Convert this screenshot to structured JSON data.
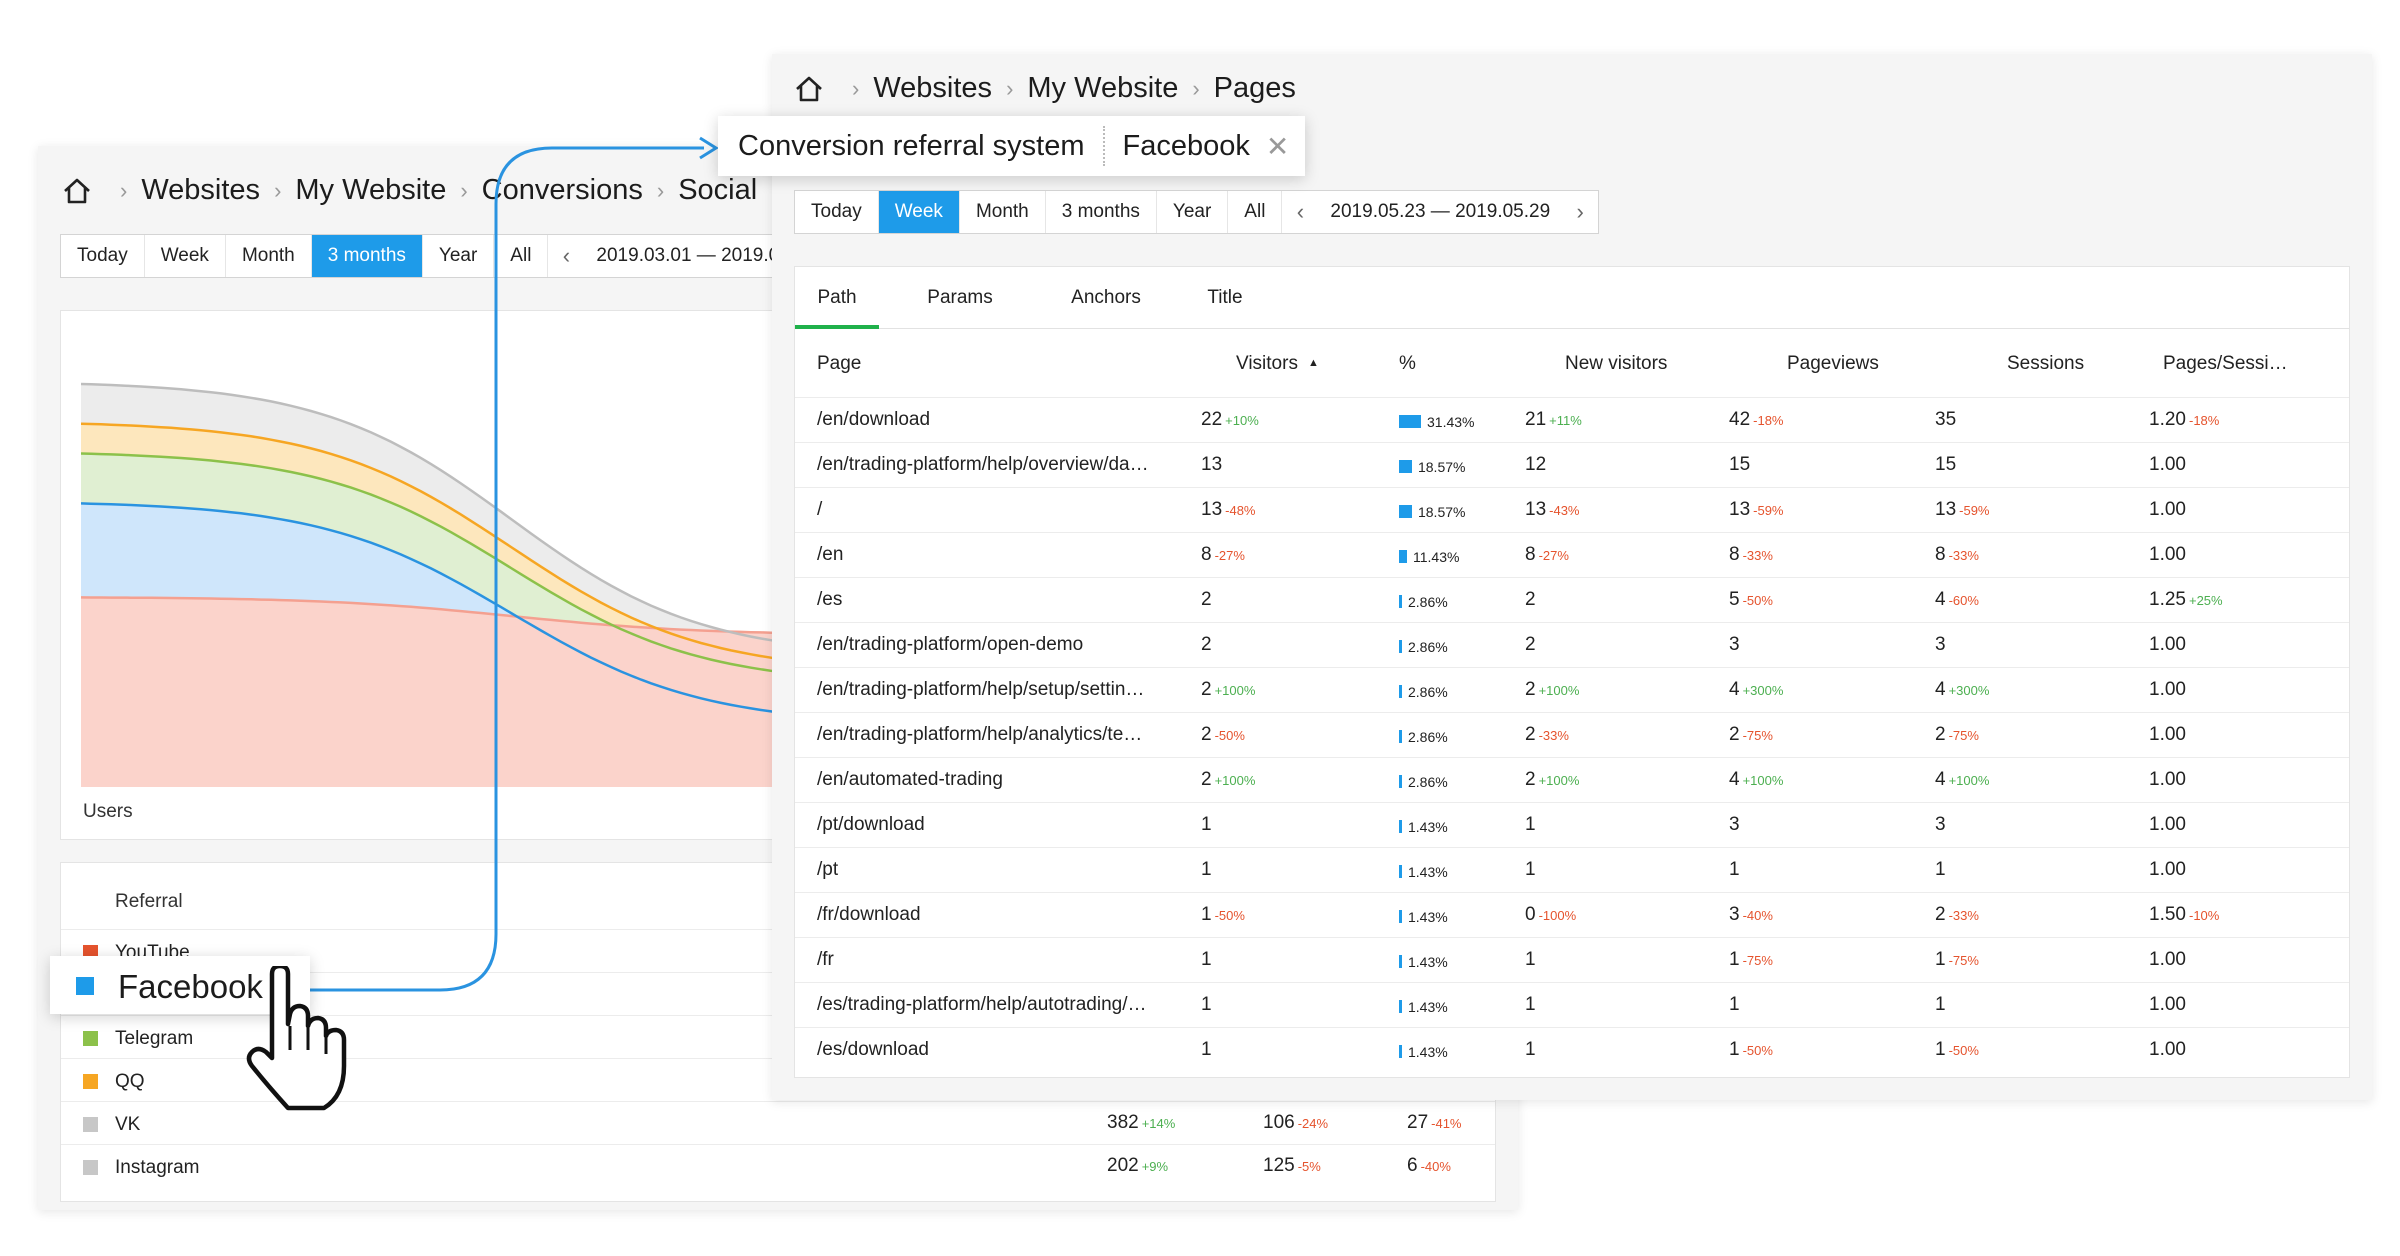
{
  "back_panel": {
    "breadcrumb": {
      "items": [
        "Websites",
        "My Website",
        "Conversions",
        "Social"
      ]
    },
    "periods": {
      "items": [
        "Today",
        "Week",
        "Month",
        "3 months",
        "Year",
        "All"
      ],
      "active_index": 3,
      "date_range": "2019.03.01 — 2019.0"
    },
    "chart_data": {
      "type": "area",
      "stacked": true,
      "ylabel": "Users",
      "series": [
        {
          "color": "#fbd3cb",
          "edge": "#f4a090"
        },
        {
          "color": "#cfe6fb",
          "edge": "#2a93e0"
        },
        {
          "color": "#e0efd2",
          "edge": "#8cc14a"
        },
        {
          "color": "#fde7bd",
          "edge": "#f6a623"
        },
        {
          "color": "#ececec",
          "edge": "#bdbdbd"
        }
      ]
    },
    "table": {
      "header": "Referral",
      "rows": [
        {
          "name": "YouTube",
          "color": "#e5532d",
          "cols": []
        },
        {
          "name": "Facebook",
          "color": "#1e9be9",
          "cols": []
        },
        {
          "name": "Telegram",
          "color": "#8cc14a",
          "cols": []
        },
        {
          "name": "QQ",
          "color": "#f6a623",
          "cols": []
        },
        {
          "name": "VK",
          "color": "#c7c7c7",
          "cols": [
            {
              "v": "382",
              "d": "+14%"
            },
            {
              "v": "106",
              "d": "-24%"
            },
            {
              "v": "27",
              "d": "-41%"
            }
          ]
        },
        {
          "name": "Instagram",
          "color": "#c7c7c7",
          "cols": [
            {
              "v": "202",
              "d": "+9%"
            },
            {
              "v": "125",
              "d": "-5%"
            },
            {
              "v": "6",
              "d": "-40%"
            }
          ]
        }
      ]
    }
  },
  "front_panel": {
    "breadcrumb": {
      "items": [
        "Websites",
        "My Website",
        "Pages"
      ]
    },
    "periods": {
      "items": [
        "Today",
        "Week",
        "Month",
        "3 months",
        "Year",
        "All"
      ],
      "active_index": 1,
      "date_range": "2019.05.23 — 2019.05.29"
    },
    "tabs": [
      "Path",
      "Params",
      "Anchors",
      "Title"
    ],
    "columns": [
      "Page",
      "Visitors",
      "%",
      "New visitors",
      "Pageviews",
      "Sessions",
      "Pages/Sessi…"
    ],
    "rows": [
      {
        "page": "/en/download",
        "visitors": "22",
        "visitors_d": "+10%",
        "pct": 31.43,
        "pct_label": "31.43%",
        "new": "21",
        "new_d": "+11%",
        "views": "42",
        "views_d": "-18%",
        "sessions": "35",
        "sessions_d": "",
        "pps": "1.20",
        "pps_d": "-18%"
      },
      {
        "page": "/en/trading-platform/help/overview/da…",
        "visitors": "13",
        "visitors_d": "",
        "pct": 18.57,
        "pct_label": "18.57%",
        "new": "12",
        "new_d": "",
        "views": "15",
        "views_d": "",
        "sessions": "15",
        "sessions_d": "",
        "pps": "1.00",
        "pps_d": ""
      },
      {
        "page": "/",
        "visitors": "13",
        "visitors_d": "-48%",
        "pct": 18.57,
        "pct_label": "18.57%",
        "new": "13",
        "new_d": "-43%",
        "views": "13",
        "views_d": "-59%",
        "sessions": "13",
        "sessions_d": "-59%",
        "pps": "1.00",
        "pps_d": ""
      },
      {
        "page": "/en",
        "visitors": "8",
        "visitors_d": "-27%",
        "pct": 11.43,
        "pct_label": "11.43%",
        "new": "8",
        "new_d": "-27%",
        "views": "8",
        "views_d": "-33%",
        "sessions": "8",
        "sessions_d": "-33%",
        "pps": "1.00",
        "pps_d": ""
      },
      {
        "page": "/es",
        "visitors": "2",
        "visitors_d": "",
        "pct": 2.86,
        "pct_label": "2.86%",
        "new": "2",
        "new_d": "",
        "views": "5",
        "views_d": "-50%",
        "sessions": "4",
        "sessions_d": "-60%",
        "pps": "1.25",
        "pps_d": "+25%"
      },
      {
        "page": "/en/trading-platform/open-demo",
        "visitors": "2",
        "visitors_d": "",
        "pct": 2.86,
        "pct_label": "2.86%",
        "new": "2",
        "new_d": "",
        "views": "3",
        "views_d": "",
        "sessions": "3",
        "sessions_d": "",
        "pps": "1.00",
        "pps_d": ""
      },
      {
        "page": "/en/trading-platform/help/setup/settin…",
        "visitors": "2",
        "visitors_d": "+100%",
        "pct": 2.86,
        "pct_label": "2.86%",
        "new": "2",
        "new_d": "+100%",
        "views": "4",
        "views_d": "+300%",
        "sessions": "4",
        "sessions_d": "+300%",
        "pps": "1.00",
        "pps_d": ""
      },
      {
        "page": "/en/trading-platform/help/analytics/te…",
        "visitors": "2",
        "visitors_d": "-50%",
        "pct": 2.86,
        "pct_label": "2.86%",
        "new": "2",
        "new_d": "-33%",
        "views": "2",
        "views_d": "-75%",
        "sessions": "2",
        "sessions_d": "-75%",
        "pps": "1.00",
        "pps_d": ""
      },
      {
        "page": "/en/automated-trading",
        "visitors": "2",
        "visitors_d": "+100%",
        "pct": 2.86,
        "pct_label": "2.86%",
        "new": "2",
        "new_d": "+100%",
        "views": "4",
        "views_d": "+100%",
        "sessions": "4",
        "sessions_d": "+100%",
        "pps": "1.00",
        "pps_d": ""
      },
      {
        "page": "/pt/download",
        "visitors": "1",
        "visitors_d": "",
        "pct": 1.43,
        "pct_label": "1.43%",
        "new": "1",
        "new_d": "",
        "views": "3",
        "views_d": "",
        "sessions": "3",
        "sessions_d": "",
        "pps": "1.00",
        "pps_d": ""
      },
      {
        "page": "/pt",
        "visitors": "1",
        "visitors_d": "",
        "pct": 1.43,
        "pct_label": "1.43%",
        "new": "1",
        "new_d": "",
        "views": "1",
        "views_d": "",
        "sessions": "1",
        "sessions_d": "",
        "pps": "1.00",
        "pps_d": ""
      },
      {
        "page": "/fr/download",
        "visitors": "1",
        "visitors_d": "-50%",
        "pct": 1.43,
        "pct_label": "1.43%",
        "new": "0",
        "new_d": "-100%",
        "views": "3",
        "views_d": "-40%",
        "sessions": "2",
        "sessions_d": "-33%",
        "pps": "1.50",
        "pps_d": "-10%"
      },
      {
        "page": "/fr",
        "visitors": "1",
        "visitors_d": "",
        "pct": 1.43,
        "pct_label": "1.43%",
        "new": "1",
        "new_d": "",
        "views": "1",
        "views_d": "-75%",
        "sessions": "1",
        "sessions_d": "-75%",
        "pps": "1.00",
        "pps_d": ""
      },
      {
        "page": "/es/trading-platform/help/autotrading/…",
        "visitors": "1",
        "visitors_d": "",
        "pct": 1.43,
        "pct_label": "1.43%",
        "new": "1",
        "new_d": "",
        "views": "1",
        "views_d": "",
        "sessions": "1",
        "sessions_d": "",
        "pps": "1.00",
        "pps_d": ""
      },
      {
        "page": "/es/download",
        "visitors": "1",
        "visitors_d": "",
        "pct": 1.43,
        "pct_label": "1.43%",
        "new": "1",
        "new_d": "",
        "views": "1",
        "views_d": "-50%",
        "sessions": "1",
        "sessions_d": "-50%",
        "pps": "1.00",
        "pps_d": ""
      }
    ]
  },
  "filter_chip": {
    "segment": "Conversion referral system",
    "value": "Facebook"
  },
  "facebook_chip": {
    "label": "Facebook"
  },
  "colors": {
    "accent": "#1e9be9",
    "active_tab": "#1fb14b",
    "positive": "#4caf50",
    "negative": "#e5532d"
  }
}
